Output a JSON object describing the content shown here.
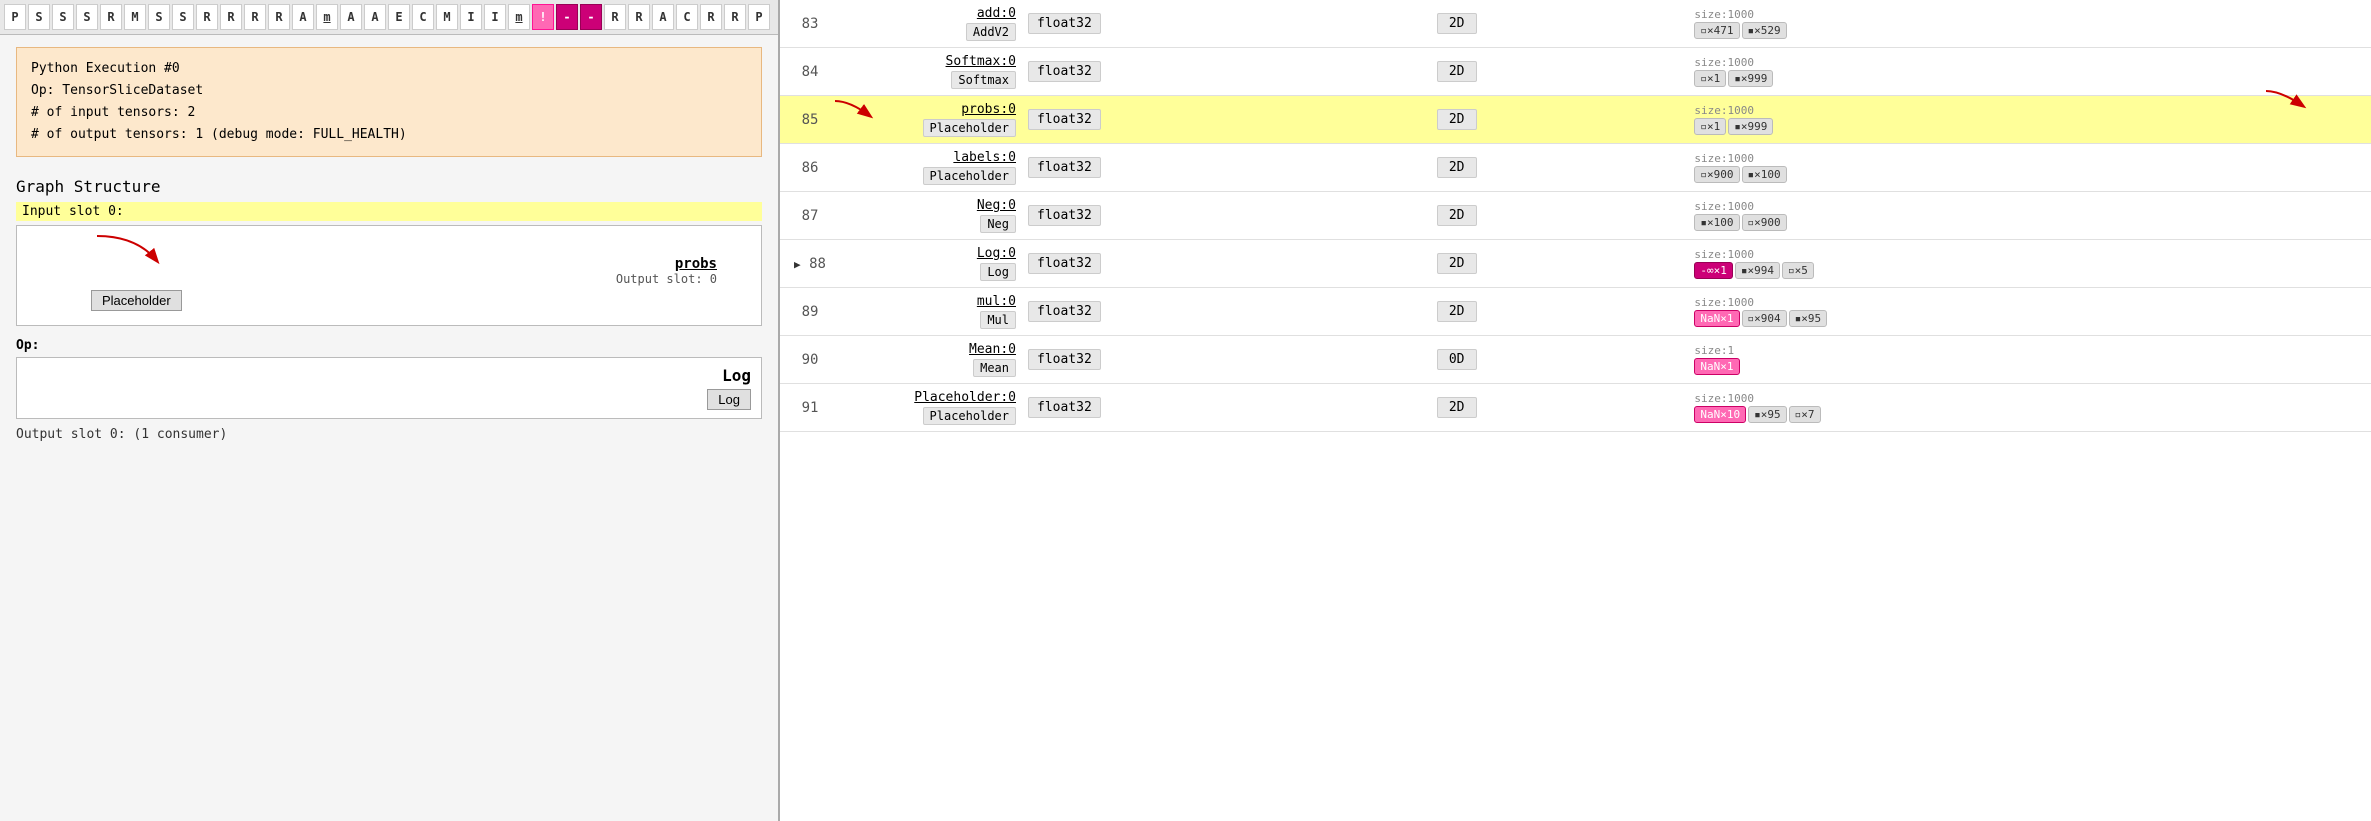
{
  "charBar": {
    "cells": [
      "P",
      "S",
      "S",
      "S",
      "R",
      "M",
      "S",
      "S",
      "R",
      "R",
      "R",
      "R",
      "A",
      "m",
      "A",
      "A",
      "E",
      "C",
      "M",
      "I",
      "I",
      "m",
      "!",
      "-",
      "-",
      "R",
      "R",
      "A",
      "C",
      "R",
      "R",
      "P"
    ]
  },
  "infoBox": {
    "title": "Python Execution #0",
    "op": "Op:  TensorSliceDataset",
    "inputTensors": "# of input tensors:  2",
    "outputTensors": "# of output tensors:  1   (debug mode: FULL_HEALTH)"
  },
  "graphStructure": {
    "title": "Graph Structure",
    "inputSlotLabel": "Input slot 0:",
    "probsLink": "probs",
    "outputSlot": "Output slot: 0",
    "placeholderBtn": "Placeholder"
  },
  "opSection": {
    "label": "Op:",
    "name": "Log",
    "btn": "Log"
  },
  "outputSlotFooter": "Output slot 0: (1 consumer)",
  "rightTable": {
    "rows": [
      {
        "num": "83",
        "opLink": "add:0",
        "opType": "AddV2",
        "dtype": "float32",
        "dim": "2D",
        "sizeLabel": "size:1000",
        "chips": [
          {
            "label": "▫×471",
            "type": "gray"
          },
          {
            "label": "▪×529",
            "type": "gray"
          }
        ],
        "hasArrow": false,
        "highlighted": false,
        "redArrowOp": false,
        "redArrowSize": false
      },
      {
        "num": "84",
        "opLink": "Softmax:0",
        "opType": "Softmax",
        "dtype": "float32",
        "dim": "2D",
        "sizeLabel": "size:1000",
        "chips": [
          {
            "label": "▫×1",
            "type": "gray"
          },
          {
            "label": "▪×999",
            "type": "gray"
          }
        ],
        "hasArrow": false,
        "highlighted": false,
        "redArrowOp": false,
        "redArrowSize": false
      },
      {
        "num": "85",
        "opLink": "probs:0",
        "opType": "Placeholder",
        "dtype": "float32",
        "dim": "2D",
        "sizeLabel": "size:1000",
        "chips": [
          {
            "label": "▫×1",
            "type": "gray"
          },
          {
            "label": "▪×999",
            "type": "gray"
          }
        ],
        "hasArrow": false,
        "highlighted": true,
        "redArrowOp": true,
        "redArrowSize": true
      },
      {
        "num": "86",
        "opLink": "labels:0",
        "opType": "Placeholder",
        "dtype": "float32",
        "dim": "2D",
        "sizeLabel": "size:1000",
        "chips": [
          {
            "label": "▫×900",
            "type": "gray"
          },
          {
            "label": "▪×100",
            "type": "gray"
          }
        ],
        "hasArrow": false,
        "highlighted": false,
        "redArrowOp": false,
        "redArrowSize": false
      },
      {
        "num": "87",
        "opLink": "Neg:0",
        "opType": "Neg",
        "dtype": "float32",
        "dim": "2D",
        "sizeLabel": "size:1000",
        "chips": [
          {
            "label": "▪×100",
            "type": "gray"
          },
          {
            "label": "▫×900",
            "type": "gray"
          }
        ],
        "hasArrow": false,
        "highlighted": false,
        "redArrowOp": false,
        "redArrowSize": false
      },
      {
        "num": "88",
        "opLink": "Log:0",
        "opType": "Log",
        "dtype": "float32",
        "dim": "2D",
        "sizeLabel": "size:1000",
        "chips": [
          {
            "label": "-∞×1",
            "type": "neginf"
          },
          {
            "label": "▪×994",
            "type": "gray"
          },
          {
            "label": "▫×5",
            "type": "gray"
          }
        ],
        "hasArrow": true,
        "highlighted": false,
        "redArrowOp": false,
        "redArrowSize": false
      },
      {
        "num": "89",
        "opLink": "mul:0",
        "opType": "Mul",
        "dtype": "float32",
        "dim": "2D",
        "sizeLabel": "size:1000",
        "chips": [
          {
            "label": "NaN×1",
            "type": "nan"
          },
          {
            "label": "▫×904",
            "type": "gray"
          },
          {
            "label": "▪×95",
            "type": "gray"
          }
        ],
        "hasArrow": false,
        "highlighted": false,
        "redArrowOp": false,
        "redArrowSize": false
      },
      {
        "num": "90",
        "opLink": "Mean:0",
        "opType": "Mean",
        "dtype": "float32",
        "dim": "0D",
        "sizeLabel": "size:1",
        "chips": [
          {
            "label": "NaN×1",
            "type": "nan"
          }
        ],
        "hasArrow": false,
        "highlighted": false,
        "redArrowOp": false,
        "redArrowSize": false
      },
      {
        "num": "91",
        "opLink": "Placeholder:0",
        "opType": "Placeholder",
        "dtype": "float32",
        "dim": "2D",
        "sizeLabel": "size:1000",
        "chips": [
          {
            "label": "NaN×10",
            "type": "nan"
          },
          {
            "label": "▪×95",
            "type": "gray"
          },
          {
            "label": "▫×7",
            "type": "gray"
          }
        ],
        "hasArrow": false,
        "highlighted": false,
        "redArrowOp": false,
        "redArrowSize": false
      }
    ]
  },
  "labels": {
    "op": "Op:",
    "graphTitle": "Graph Structure",
    "inputSlot": "Input slot 0:",
    "outputSlotFooter": "Output slot 0: (1 consumer)"
  }
}
